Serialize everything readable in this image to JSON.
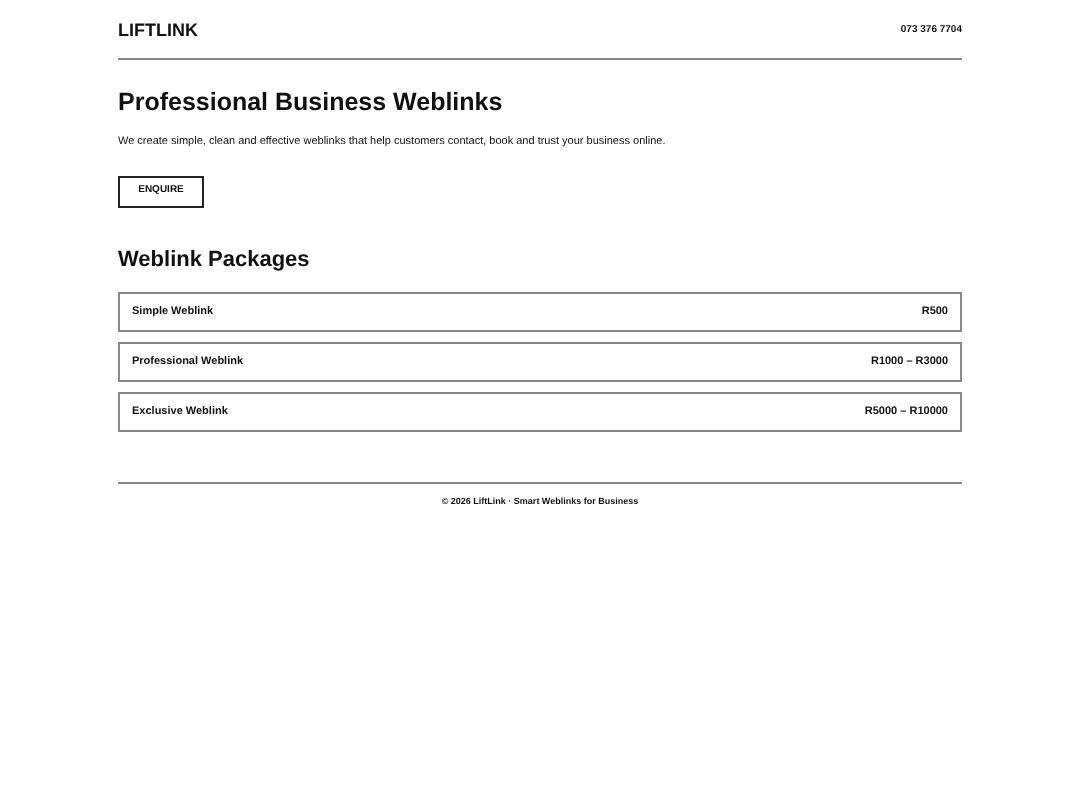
{
  "header": {
    "logo": "LIFTLINK",
    "phone": "073 376 7704"
  },
  "hero": {
    "title": "Professional Business Weblinks",
    "text": "We create simple, clean and effective weblinks that help customers contact, book and trust your business online.",
    "button": "ENQUIRE"
  },
  "packages": {
    "title": "Weblink Packages",
    "items": [
      {
        "name": "Simple Weblink",
        "price": "R500"
      },
      {
        "name": "Professional Weblink",
        "price": "R1000 – R3000"
      },
      {
        "name": "Exclusive Weblink",
        "price": "R5000 – R10000"
      }
    ]
  },
  "footer": "© 2026 LiftLink · Smart Weblinks for Business"
}
